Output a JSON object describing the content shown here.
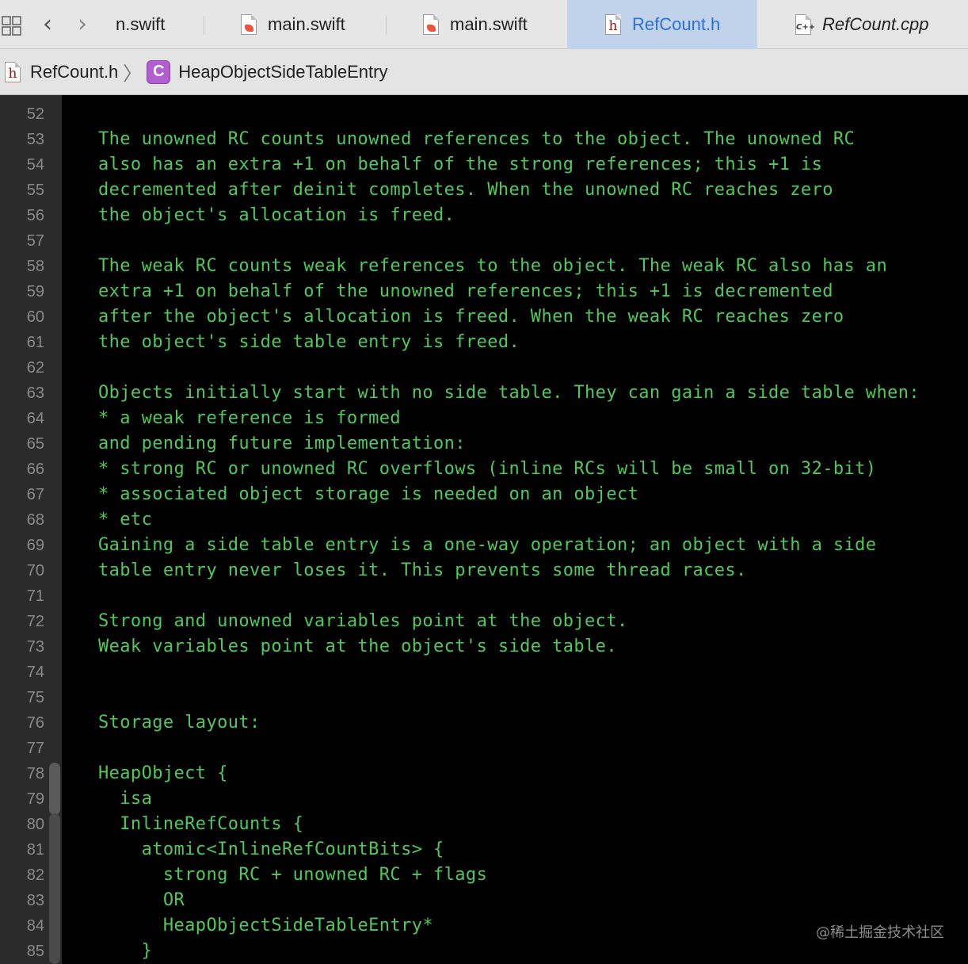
{
  "tabs": [
    {
      "label": "n.swift",
      "icon": "swift-file-icon",
      "active": false
    },
    {
      "label": "main.swift",
      "icon": "swift-file-icon",
      "active": false
    },
    {
      "label": "main.swift",
      "icon": "swift-file-icon",
      "active": false
    },
    {
      "label": "RefCount.h",
      "icon": "header-file-icon",
      "active": true
    },
    {
      "label": "RefCount.cpp",
      "icon": "cpp-file-icon",
      "active": false
    }
  ],
  "jumpbar": {
    "file": "RefCount.h",
    "class_badge": "C",
    "symbol": "HeapObjectSideTableEntry"
  },
  "icons": {
    "header_glyph": "h",
    "cpp_glyph": "C++",
    "back": "‹",
    "forward": "›",
    "chevron": "〉"
  },
  "editor": {
    "lines": [
      {
        "n": "52",
        "text": ""
      },
      {
        "n": "53",
        "text": "The unowned RC counts unowned references to the object. The unowned RC"
      },
      {
        "n": "54",
        "text": "also has an extra +1 on behalf of the strong references; this +1 is"
      },
      {
        "n": "55",
        "text": "decremented after deinit completes. When the unowned RC reaches zero"
      },
      {
        "n": "56",
        "text": "the object's allocation is freed."
      },
      {
        "n": "57",
        "text": ""
      },
      {
        "n": "58",
        "text": "The weak RC counts weak references to the object. The weak RC also has an"
      },
      {
        "n": "59",
        "text": "extra +1 on behalf of the unowned references; this +1 is decremented"
      },
      {
        "n": "60",
        "text": "after the object's allocation is freed. When the weak RC reaches zero"
      },
      {
        "n": "61",
        "text": "the object's side table entry is freed."
      },
      {
        "n": "62",
        "text": ""
      },
      {
        "n": "63",
        "text": "Objects initially start with no side table. They can gain a side table when:"
      },
      {
        "n": "64",
        "text": "* a weak reference is formed"
      },
      {
        "n": "65",
        "text": "and pending future implementation:"
      },
      {
        "n": "66",
        "text": "* strong RC or unowned RC overflows (inline RCs will be small on 32-bit)"
      },
      {
        "n": "67",
        "text": "* associated object storage is needed on an object"
      },
      {
        "n": "68",
        "text": "* etc"
      },
      {
        "n": "69",
        "text": "Gaining a side table entry is a one-way operation; an object with a side"
      },
      {
        "n": "70",
        "text": "table entry never loses it. This prevents some thread races."
      },
      {
        "n": "71",
        "text": ""
      },
      {
        "n": "72",
        "text": "Strong and unowned variables point at the object."
      },
      {
        "n": "73",
        "text": "Weak variables point at the object's side table."
      },
      {
        "n": "74",
        "text": ""
      },
      {
        "n": "75",
        "text": ""
      },
      {
        "n": "76",
        "text": "Storage layout:"
      },
      {
        "n": "77",
        "text": ""
      },
      {
        "n": "78",
        "text": "HeapObject {"
      },
      {
        "n": "79",
        "text": "  isa"
      },
      {
        "n": "80",
        "text": "  InlineRefCounts {"
      },
      {
        "n": "81",
        "text": "    atomic<InlineRefCountBits> {"
      },
      {
        "n": "82",
        "text": "      strong RC + unowned RC + flags"
      },
      {
        "n": "83",
        "text": "      OR"
      },
      {
        "n": "84",
        "text": "      HeapObjectSideTableEntry*"
      },
      {
        "n": "85",
        "text": "    }"
      }
    ]
  },
  "watermark": "@稀土掘金技术社区",
  "colors": {
    "code_comment_green": "#52c85b",
    "line_number": "#8a8a8a",
    "active_tab_bg": "#c0d3ea",
    "active_tab_text": "#2d6fd6",
    "class_badge": "#b05ed0"
  }
}
